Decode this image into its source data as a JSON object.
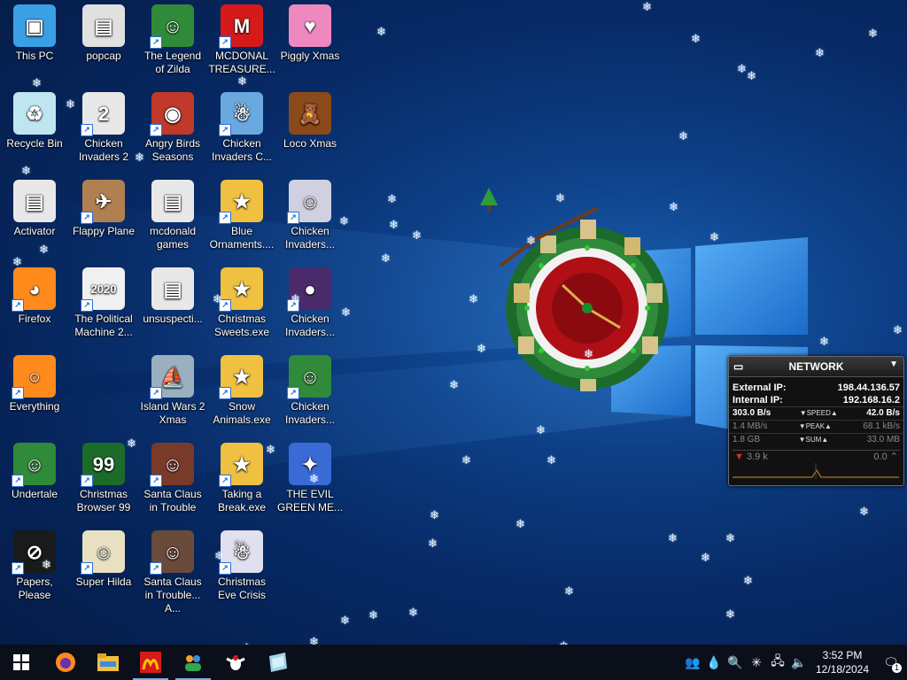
{
  "desktop": {
    "icons": [
      {
        "label": "This PC"
      },
      {
        "label": "popcap"
      },
      {
        "label": "The Legend of Zilda"
      },
      {
        "label": "MCDONAL TREASURE..."
      },
      {
        "label": "Piggly Xmas"
      },
      {
        "label": "Recycle Bin"
      },
      {
        "label": "Chicken Invaders 2"
      },
      {
        "label": "Angry Birds Seasons"
      },
      {
        "label": "Chicken Invaders C..."
      },
      {
        "label": "Loco Xmas"
      },
      {
        "label": "Activator"
      },
      {
        "label": "Flappy Plane"
      },
      {
        "label": "mcdonald games"
      },
      {
        "label": "Blue Ornaments...."
      },
      {
        "label": "Chicken Invaders..."
      },
      {
        "label": "Firefox"
      },
      {
        "label": "The Political Machine 2..."
      },
      {
        "label": "unsuspecti..."
      },
      {
        "label": "Christmas Sweets.exe"
      },
      {
        "label": "Chicken Invaders..."
      },
      {
        "label": "Everything"
      },
      {
        "label": "Island Wars 2 Xmas"
      },
      {
        "label": "Snow Animals.exe"
      },
      {
        "label": "Chicken Invaders..."
      },
      {
        "label": "Undertale"
      },
      {
        "label": "Christmas Browser 99"
      },
      {
        "label": "Santa Claus in Trouble"
      },
      {
        "label": "Taking a Break.exe"
      },
      {
        "label": "THE EVIL GREEN ME..."
      },
      {
        "label": "Papers, Please"
      },
      {
        "label": "Super Hilda"
      },
      {
        "label": "Santa Claus in Trouble... A..."
      },
      {
        "label": "Christmas Eve Crisis"
      }
    ]
  },
  "network_widget": {
    "title": "NETWORK",
    "external_ip_label": "External IP:",
    "external_ip": "198.44.136.57",
    "internal_ip_label": "Internal IP:",
    "internal_ip": "192.168.16.2",
    "speed_left": "303.0 B/s",
    "speed_label": "SPEED",
    "speed_right": "42.0 B/s",
    "peak_left": "1.4 MB/s",
    "peak_label": "PEAK",
    "peak_right": "68.1 kB/s",
    "sum_left": "1.8 GB",
    "sum_label": "SUM",
    "sum_right": "33.0 MB",
    "graph_left": "3.9 k",
    "graph_right": "0.0"
  },
  "taskbar": {
    "time": "3:52 PM",
    "date": "12/18/2024",
    "notification_count": "1"
  },
  "colors": {
    "taskbar_bg": "#0a0f1a",
    "accent": "#7fb0e6",
    "widget_bg": "#111111"
  }
}
